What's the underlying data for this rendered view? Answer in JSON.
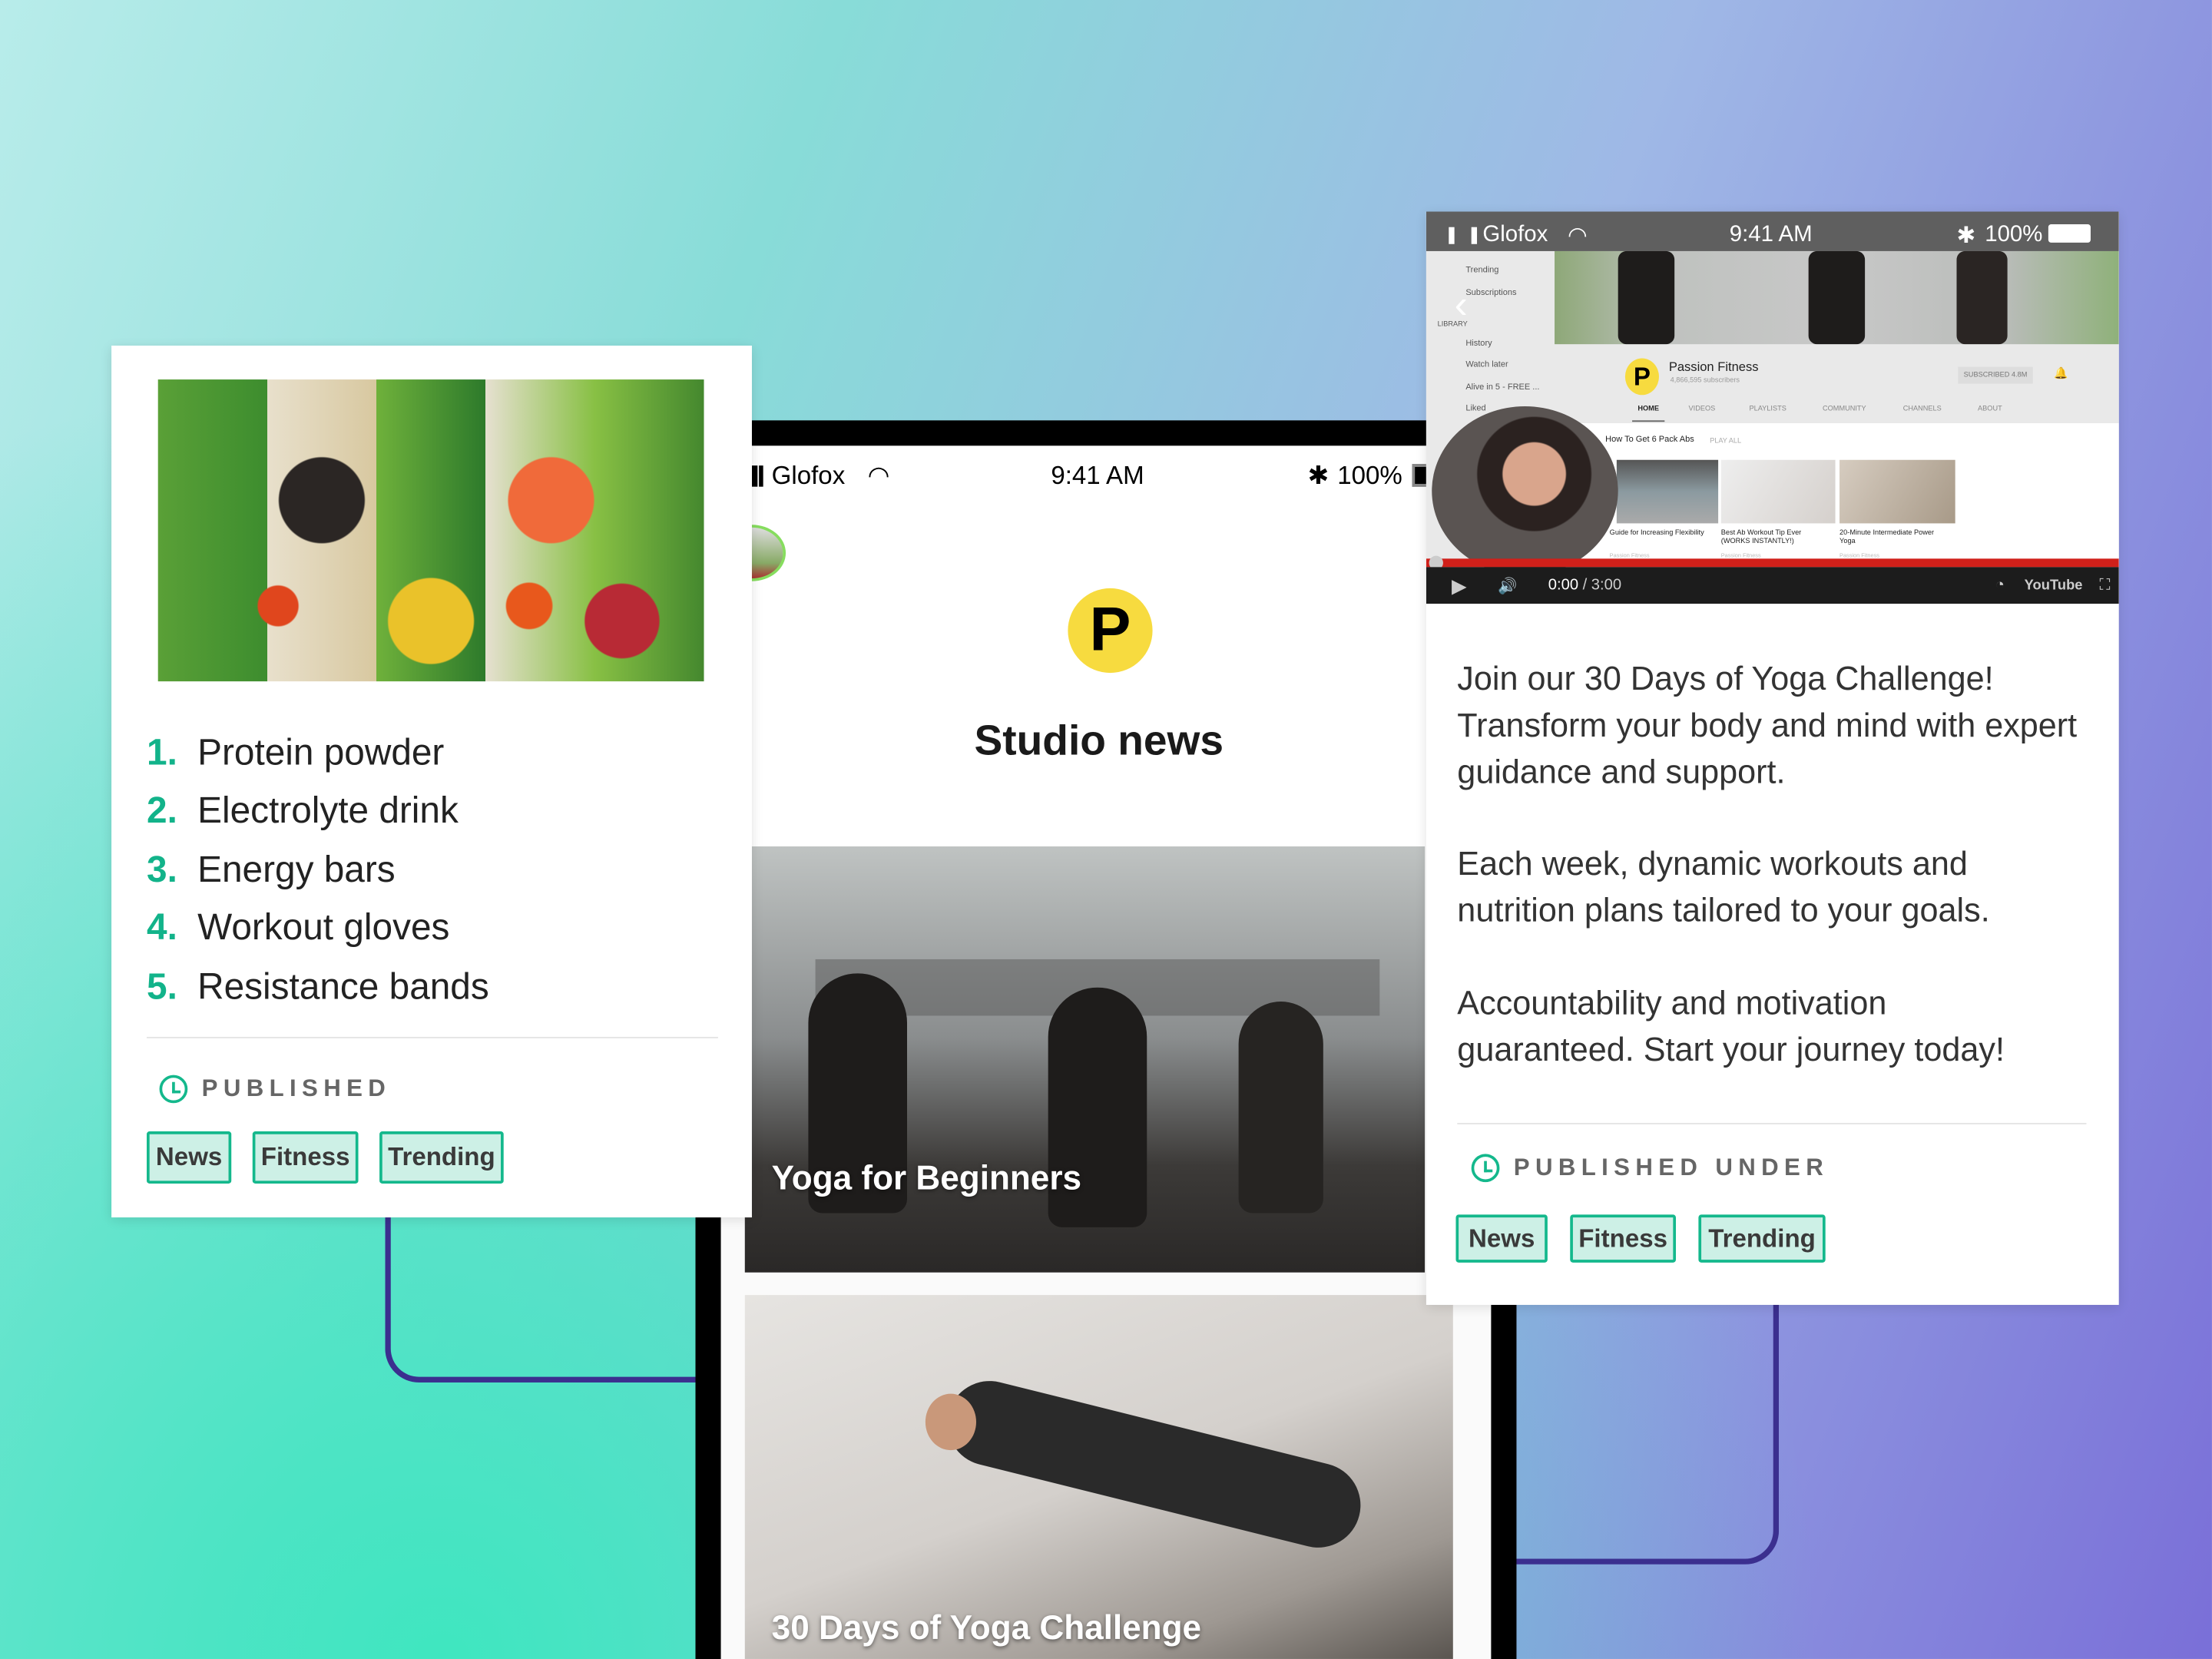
{
  "left_card": {
    "items": [
      {
        "n": "1.",
        "label": "Protein powder"
      },
      {
        "n": "2.",
        "label": "Electrolyte drink"
      },
      {
        "n": "3.",
        "label": "Energy bars"
      },
      {
        "n": "4.",
        "label": "Workout gloves"
      },
      {
        "n": "5.",
        "label": "Resistance bands"
      }
    ],
    "published_label": "PUBLISHED",
    "tags": [
      "News",
      "Fitness",
      "Trending"
    ]
  },
  "phone": {
    "status": {
      "carrier": "Glofox",
      "time": "9:41 AM",
      "battery": "100%"
    },
    "title": "Studio news",
    "logo_letter": "P",
    "posts": [
      {
        "caption": "Yoga for Beginners"
      },
      {
        "caption": "30 Days of Yoga Challenge"
      }
    ]
  },
  "right_card": {
    "status": {
      "carrier": "Glofox",
      "time": "9:41 AM",
      "battery": "100%"
    },
    "video": {
      "sidebar": [
        "Trending",
        "Subscriptions",
        "LIBRARY",
        "History",
        "Watch later",
        "Alive in 5 - FREE ...",
        "Liked"
      ],
      "channel_name": "Passion Fitness",
      "subscribers": "4,866,595 subscribers",
      "subscribe_label": "SUBSCRIBED 4.8M",
      "tabs": [
        "HOME",
        "VIDEOS",
        "PLAYLISTS",
        "COMMUNITY",
        "CHANNELS",
        "ABOUT"
      ],
      "section_title": "How To Get 6 Pack Abs",
      "play_all": "PLAY ALL",
      "videos": [
        {
          "title": "Guide for Increasing Flexibility",
          "channel": "Passion Fitness"
        },
        {
          "title": "Best Ab Workout Tip Ever (WORKS INSTANTLY!)",
          "channel": "Passion Fitness"
        },
        {
          "title": "20-Minute Intermediate Power Yoga",
          "channel": "Passion Fitness"
        }
      ],
      "time": "0:00",
      "duration": "3:00",
      "progress": 0,
      "logo": "YouTube"
    },
    "paragraphs": [
      "Join our 30 Days of Yoga Challenge! Transform your body and mind with expert guidance and support.",
      "Each week, dynamic workouts and nutrition plans tailored to your goals.",
      "Accountability and motivation guaranteed. Start your journey today!"
    ],
    "published_label": "PUBLISHED UNDER",
    "tags": [
      "News",
      "Fitness",
      "Trending"
    ]
  },
  "colors": {
    "accent": "#14b88c",
    "tag_bg": "#cdf0e6",
    "line": "#3b2f8f",
    "yt_red": "#d0201a"
  }
}
